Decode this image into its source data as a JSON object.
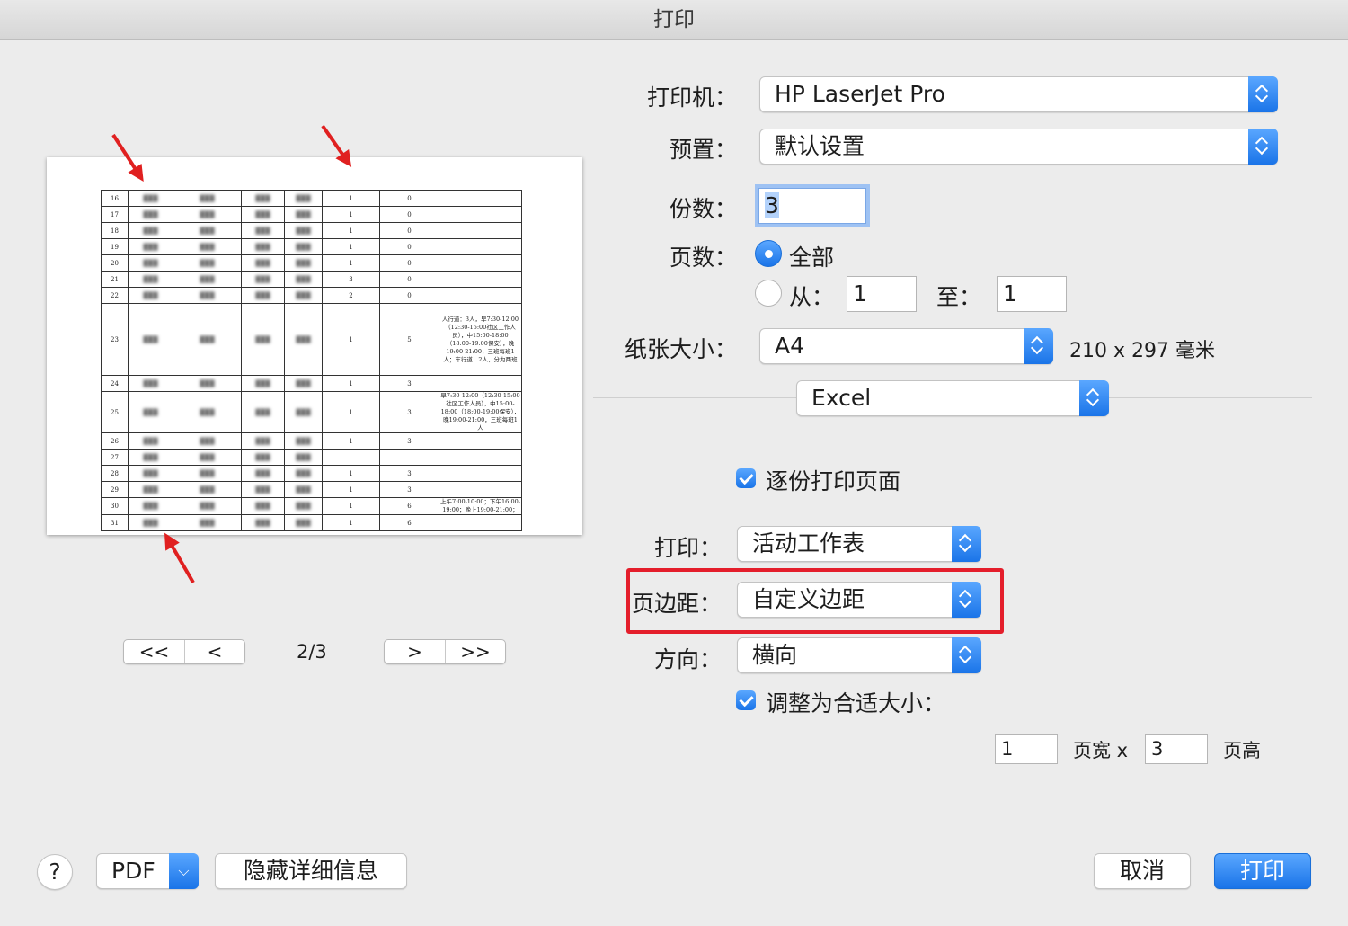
{
  "window": {
    "title": "打印"
  },
  "preview": {
    "page_indicator": "2/3",
    "nav": {
      "first": "<<",
      "prev": "<",
      "next": ">",
      "last": ">>"
    },
    "rows": [
      {
        "n": "16",
        "community": "",
        "place": "",
        "c1": "",
        "c2": "",
        "a": "1",
        "b": "0"
      },
      {
        "n": "17",
        "community": "",
        "place": "",
        "c1": "",
        "c2": "",
        "a": "1",
        "b": "0"
      },
      {
        "n": "18",
        "community": "",
        "place": "",
        "c1": "",
        "c2": "",
        "a": "1",
        "b": "0"
      },
      {
        "n": "19",
        "community": "",
        "place": "",
        "c1": "",
        "c2": "",
        "a": "1",
        "b": "0"
      },
      {
        "n": "20",
        "community": "",
        "place": "",
        "c1": "",
        "c2": "",
        "a": "1",
        "b": "0"
      },
      {
        "n": "21",
        "community": "",
        "place": "",
        "c1": "",
        "c2": "",
        "a": "3",
        "b": "0"
      },
      {
        "n": "22",
        "community": "",
        "place": "",
        "c1": "",
        "c2": "",
        "a": "2",
        "b": "0"
      },
      {
        "n": "23",
        "community": "",
        "place": "",
        "c1": "",
        "c2": "",
        "a": "1",
        "b": "5"
      },
      {
        "n": "24",
        "community": "",
        "place": "",
        "c1": "",
        "c2": "",
        "a": "1",
        "b": "3"
      },
      {
        "n": "25",
        "community": "",
        "place": "",
        "c1": "",
        "c2": "",
        "a": "1",
        "b": "3"
      },
      {
        "n": "26",
        "community": "",
        "place": "",
        "c1": "",
        "c2": "",
        "a": "1",
        "b": "3"
      },
      {
        "n": "27",
        "community": "",
        "place": "",
        "c1": "",
        "c2": "",
        "a": "",
        "b": ""
      },
      {
        "n": "28",
        "community": "",
        "place": "",
        "c1": "",
        "c2": "",
        "a": "1",
        "b": "3"
      },
      {
        "n": "29",
        "community": "",
        "place": "",
        "c1": "",
        "c2": "",
        "a": "1",
        "b": "3"
      },
      {
        "n": "30",
        "community": "",
        "place": "",
        "c1": "",
        "c2": "",
        "a": "1",
        "b": "6"
      },
      {
        "n": "31",
        "community": "",
        "place": "",
        "c1": "",
        "c2": "",
        "a": "1",
        "b": "6"
      }
    ],
    "notes": {
      "n23": "人行道：3人，早7:30-12:00（12:30-15:00社区工作人员），中15:00-18:00（18:00-19:00保安），晚19:00-21:00，三班每班1人；车行道：2人，分为两班",
      "n25": "早7:30-12:00（12:30-15:00社区工作人员），中15:00-18:00（18:00-19:00保安），晚19:00-21:00，三班每班1人",
      "n30": "上午7:00-10:00；下午16:00-19:00；晚上19:00-21:00；"
    }
  },
  "settings": {
    "printer_label": "打印机：",
    "printer_value": "HP LaserJet Pro",
    "preset_label": "预置：",
    "preset_value": "默认设置",
    "copies_label": "份数：",
    "copies_value": "3",
    "pages_label": "页数：",
    "pages_all": "全部",
    "pages_from": "从：",
    "pages_to": "至：",
    "from_value": "1",
    "to_value": "1",
    "paper_label": "纸张大小：",
    "paper_value": "A4",
    "paper_dims": "210 x 297 毫米",
    "app_section": "Excel",
    "collate_label": "逐份打印页面",
    "print_label": "打印：",
    "print_value": "活动工作表",
    "margins_label": "页边距：",
    "margins_value": "自定义边距",
    "orientation_label": "方向：",
    "orientation_value": "横向",
    "fit_label": "调整为合适大小：",
    "fit_wide_value": "1",
    "fit_wide_label": "页宽 x",
    "fit_tall_value": "3",
    "fit_tall_label": "页高"
  },
  "footer": {
    "help": "?",
    "pdf": "PDF",
    "hide_details": "隐藏详细信息",
    "cancel": "取消",
    "print": "打印"
  },
  "colors": {
    "accent": "#1a74e8",
    "annotation": "#e41e2b"
  }
}
